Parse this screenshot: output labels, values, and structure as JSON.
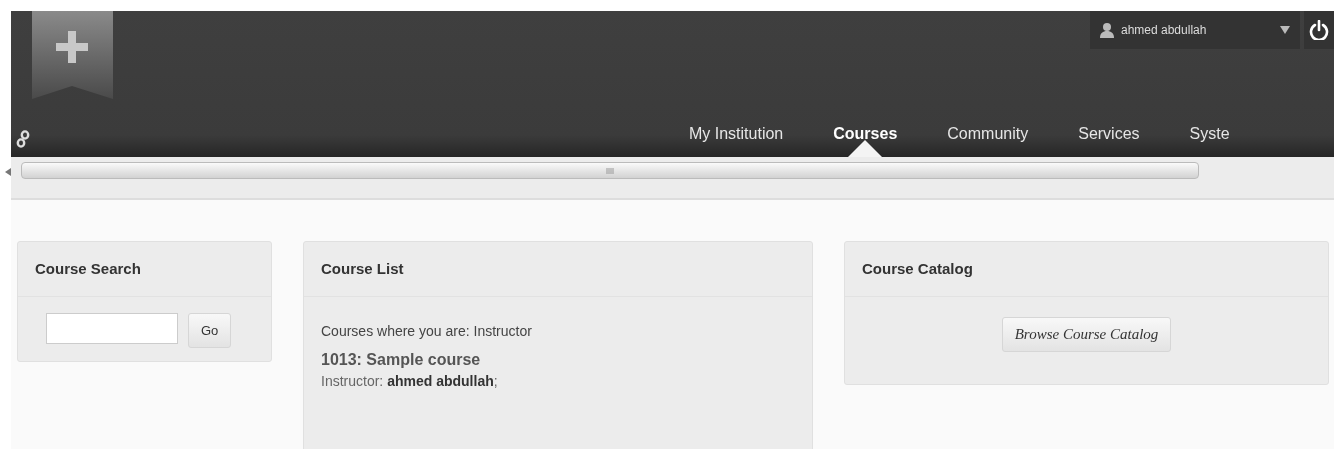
{
  "header": {
    "user": {
      "name": "ahmed abdullah"
    },
    "nav_tabs": [
      {
        "label": "My Institution",
        "selected": false
      },
      {
        "label": "Courses",
        "selected": true
      },
      {
        "label": "Community",
        "selected": false
      },
      {
        "label": "Services",
        "selected": false
      },
      {
        "label": "Syste",
        "selected": false
      }
    ]
  },
  "panels": [
    {
      "kind": "search",
      "title": "Course Search",
      "button": "Go"
    },
    {
      "kind": "list",
      "title": "Course List",
      "intro": "Courses where you are: Instructor",
      "courses": [
        {
          "title": "1013: Sample course",
          "instructor": "Instructor: **ahmed abdullah**;"
        }
      ]
    },
    {
      "kind": "catalog",
      "title": "Course Catalog",
      "button": "Browse Course Catalog"
    }
  ]
}
